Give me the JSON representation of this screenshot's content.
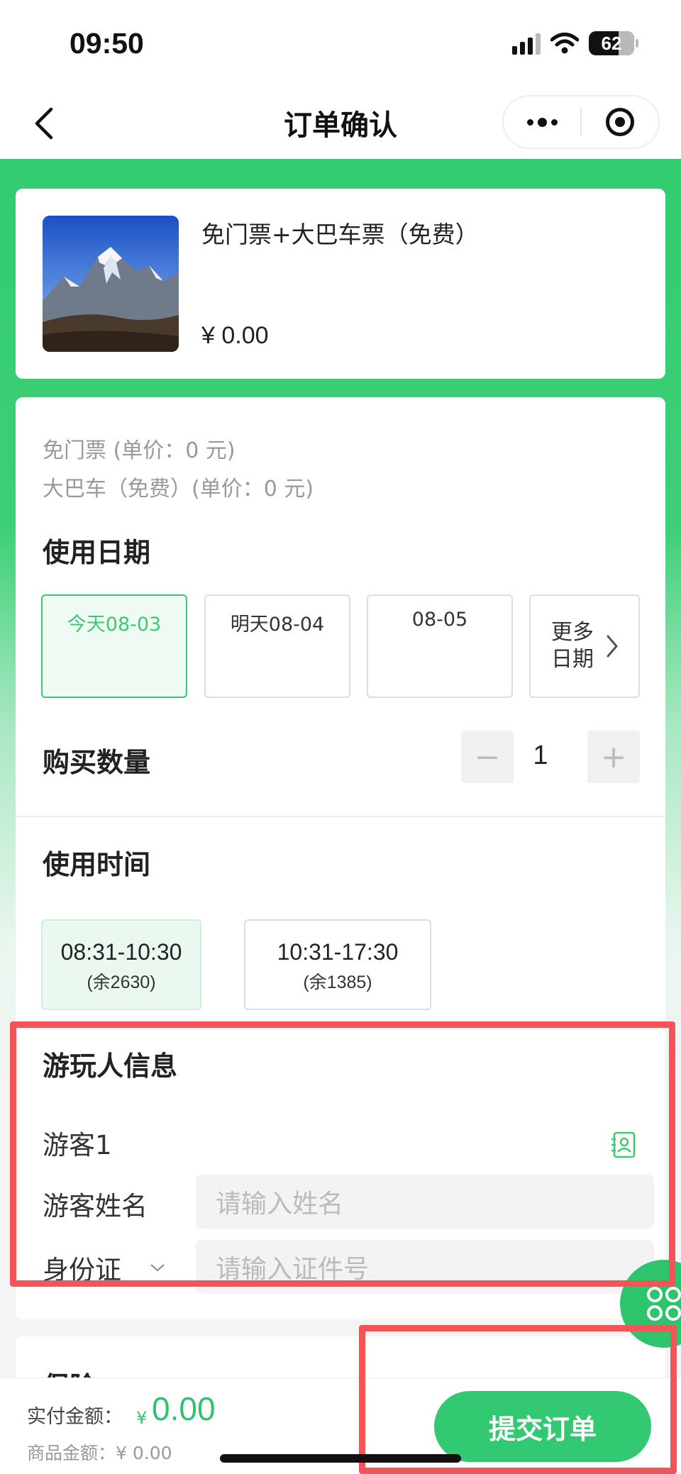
{
  "status_bar": {
    "time": "09:50",
    "battery": "62"
  },
  "nav": {
    "title": "订单确认"
  },
  "product": {
    "name": "免门票+大巴车票（免费）",
    "price": "¥ 0.00"
  },
  "ticket_lines": [
    "免门票 (单价：0 元)",
    "大巴车（免费）(单价：0 元)"
  ],
  "use_date": {
    "title": "使用日期",
    "options": [
      {
        "label": "今天08-03",
        "selected": true
      },
      {
        "label": "明天08-04",
        "selected": false
      },
      {
        "label": "08-05",
        "selected": false
      }
    ],
    "more_line1": "更多",
    "more_line2": "日期"
  },
  "quantity": {
    "title": "购买数量",
    "value": "1",
    "minus": "−",
    "plus": "+"
  },
  "use_time": {
    "title": "使用时间",
    "slots": [
      {
        "range": "08:31-10:30",
        "remain": "(余2630)",
        "selected": true
      },
      {
        "range": "10:31-17:30",
        "remain": "(余1385)",
        "selected": false
      }
    ]
  },
  "visitor_info": {
    "title": "游玩人信息",
    "visitor_label": "游客1",
    "name_label": "游客姓名",
    "name_placeholder": "请输入姓名",
    "id_type": "身份证",
    "id_placeholder": "请输入证件号"
  },
  "insurance": {
    "title": "保险"
  },
  "footer": {
    "pay_label": "实付金额：",
    "currency": "¥",
    "pay_amount": "0.00",
    "goods_label": "商品金额：¥ 0.00",
    "submit": "提交订单"
  },
  "colors": {
    "accent": "#33c972",
    "highlight_box": "#f25457"
  },
  "icons": [
    "back-icon",
    "more-dots-icon",
    "target-icon",
    "chevron-right-icon",
    "chevron-down-icon",
    "contact-book-icon",
    "grid-app-icon"
  ]
}
